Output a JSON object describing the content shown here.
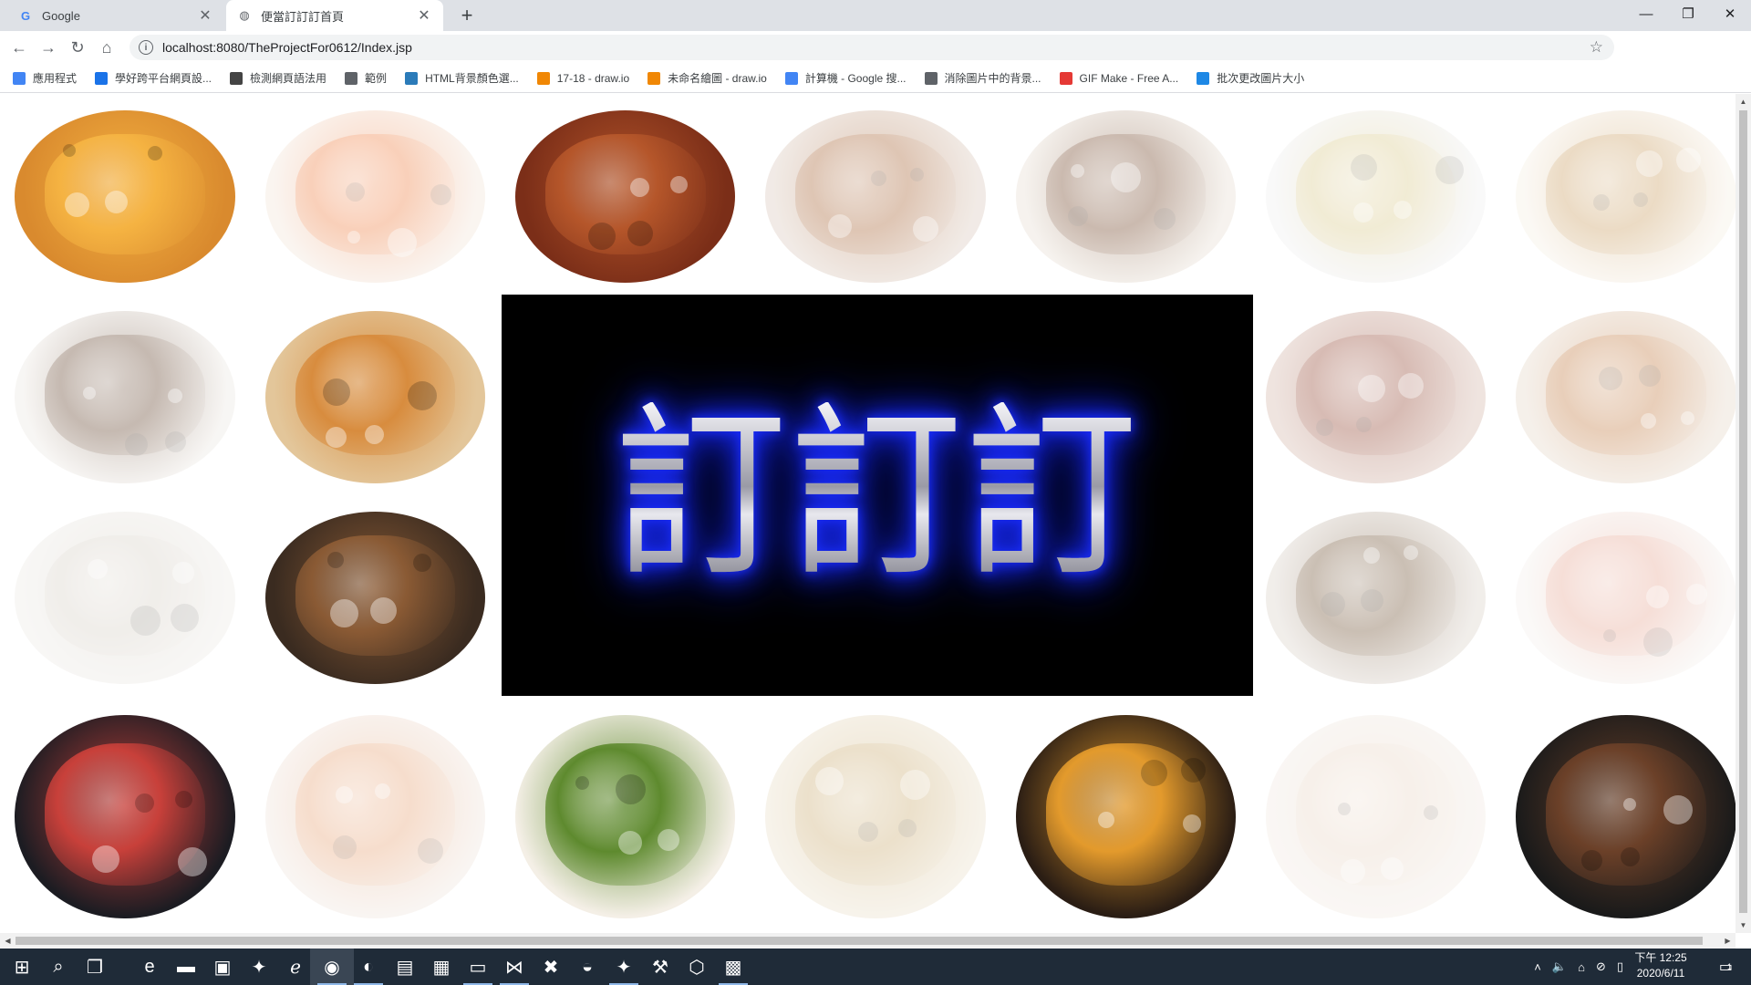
{
  "browser": {
    "tabs": [
      {
        "title": "Google",
        "favicon": "google-g-icon"
      },
      {
        "title": "便當訂訂訂首頁",
        "favicon": "globe-icon"
      }
    ],
    "new_tab_symbol": "+",
    "window_controls": {
      "minimize": "—",
      "maximize": "❐",
      "close": "✕"
    },
    "url": "localhost:8080/TheProjectFor0612/Index.jsp",
    "bookmarks": [
      {
        "label": "應用程式",
        "icon": "apps-grid-icon",
        "color": "#4285f4"
      },
      {
        "label": "學好跨平台網頁設...",
        "icon": "play-icon",
        "color": "#1a73e8"
      },
      {
        "label": "檢測網頁語法用",
        "icon": "wolf-icon",
        "color": "#444444"
      },
      {
        "label": "範例",
        "icon": "globe-icon",
        "color": "#5f6368"
      },
      {
        "label": "HTML背景顏色選...",
        "icon": "globe-icon",
        "color": "#2b7bb9"
      },
      {
        "label": "17-18 - draw.io",
        "icon": "drawio-icon",
        "color": "#f08705"
      },
      {
        "label": "未命名繪圖 - draw.io",
        "icon": "drawio-icon",
        "color": "#f08705"
      },
      {
        "label": "計算機 - Google 搜...",
        "icon": "google-g-icon",
        "color": "#4285f4"
      },
      {
        "label": "消除圖片中的背景...",
        "icon": "layers-icon",
        "color": "#5f6368"
      },
      {
        "label": "GIF Make - Free A...",
        "icon": "gif-icon",
        "color": "#e53935"
      },
      {
        "label": "批次更改圖片大小",
        "icon": "heart-icon",
        "color": "#1e88e5"
      }
    ]
  },
  "page": {
    "logo_text": "訂訂訂",
    "tiles": [
      {
        "name": "ramen-bowl",
        "plate": "#d98a2e",
        "food": "#f5b342",
        "faded": false
      },
      {
        "name": "salmon-roe-bowl",
        "plate": "#f1e3d6",
        "food": "#f07a3a",
        "faded": true
      },
      {
        "name": "roast-duck",
        "plate": "#7b2e18",
        "food": "#b5562a",
        "faded": false
      },
      {
        "name": "eel-rice-bowl",
        "plate": "#d9c6b8",
        "food": "#a35c2a",
        "faded": true
      },
      {
        "name": "braised-pork-bowl",
        "plate": "#e6dcd0",
        "food": "#6b3b1c",
        "faded": true
      },
      {
        "name": "scallion-pancake",
        "plate": "#eeeeee",
        "food": "#d9c887",
        "faded": true
      },
      {
        "name": "fried-cutlet",
        "plate": "#f6eee2",
        "food": "#c89a5a",
        "faded": true
      },
      {
        "name": "minced-pork-rice",
        "plate": "#ebe6e0",
        "food": "#5c3a22",
        "faded": true
      },
      {
        "name": "cheese-gratin",
        "plate": "#e3c69a",
        "food": "#d88c3e",
        "faded": false
      },
      {
        "name": "steak-slices",
        "plate": "#d2b3a6",
        "food": "#8f3f2a",
        "faded": true
      },
      {
        "name": "pork-rice-bowl",
        "plate": "#e5d6c6",
        "food": "#c0763a",
        "faded": true
      },
      {
        "name": "oyster-rice",
        "plate": "#ece9e4",
        "food": "#d6cfc4",
        "faded": true
      },
      {
        "name": "yakitori-skewers",
        "plate": "#3a2b20",
        "food": "#8a5a34",
        "faded": false
      },
      {
        "name": "chow-mein",
        "plate": "#d8cfc6",
        "food": "#6a4a2a",
        "faded": true
      },
      {
        "name": "sushi-rolls",
        "plate": "#f4f0ec",
        "food": "#e7a38f",
        "faded": true
      },
      {
        "name": "poke-bowl",
        "plate": "#1c1c22",
        "food": "#c8403a",
        "faded": false
      },
      {
        "name": "noodle-soup",
        "plate": "#efe4dc",
        "food": "#e8a070",
        "faded": true
      },
      {
        "name": "duck-leg-salad",
        "plate": "#f4efe6",
        "food": "#5e8a2e",
        "faded": false
      },
      {
        "name": "grain-bowl",
        "plate": "#eadfc8",
        "food": "#c9a96c",
        "faded": true
      },
      {
        "name": "braised-tofu-eggs",
        "plate": "#2a1d14",
        "food": "#e39a2c",
        "faded": false
      },
      {
        "name": "stinky-tofu",
        "plate": "#f1e9e2",
        "food": "#ead6c4",
        "faded": true
      },
      {
        "name": "beef-seaweed-bowl",
        "plate": "#1a1a1a",
        "food": "#6b4028",
        "faded": false
      }
    ]
  },
  "taskbar": {
    "apps": [
      "windows-start-icon",
      "search-icon",
      "task-view-icon",
      "edge-icon",
      "file-explorer-icon",
      "store-icon",
      "app-icon",
      "ie-icon",
      "chrome-icon",
      "firefox-icon",
      "notepad-icon",
      "spreadsheet-icon",
      "terminal-icon",
      "vscode-icon",
      "xampp-icon",
      "eclipse-icon",
      "app-icon",
      "tools-icon",
      "box-icon",
      "media-icon"
    ],
    "time": "下午 12:25",
    "date": "2020/6/11",
    "notification_count": "1"
  }
}
